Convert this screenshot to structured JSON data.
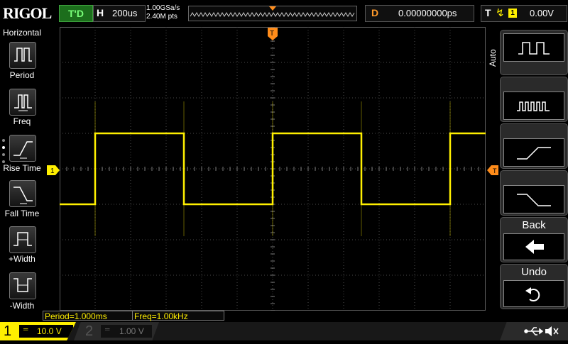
{
  "header": {
    "logo": "RIGOL",
    "trigger_status": "T'D",
    "horizontal_label": "H",
    "timebase": "200us",
    "sample_rate": "1.00GSa/s",
    "memory_depth": "2.40M pts",
    "delay_label": "D",
    "delay_value": "0.00000000ps",
    "trigger_label": "T",
    "trigger_source": "1",
    "trigger_level": "0.00V"
  },
  "left_menu": {
    "title": "Horizontal",
    "items": [
      {
        "label": "Period",
        "icon": "period-icon"
      },
      {
        "label": "Freq",
        "icon": "freq-icon"
      },
      {
        "label": "Rise Time",
        "icon": "rise-time-icon"
      },
      {
        "label": "Fall Time",
        "icon": "fall-time-icon"
      },
      {
        "label": "+Width",
        "icon": "positive-width-icon"
      },
      {
        "label": "-Width",
        "icon": "negative-width-icon"
      }
    ]
  },
  "right_menu": {
    "side_label": "Auto",
    "back_label": "Back",
    "undo_label": "Undo"
  },
  "measurements": {
    "period": "Period=1.000ms",
    "freq": "Freq=1.00kHz"
  },
  "channels": {
    "ch1": {
      "number": "1",
      "scale": "10.0 V",
      "color": "#ffef00"
    },
    "ch2": {
      "number": "2",
      "scale": "1.00 V",
      "color": "#555555"
    }
  },
  "markers": {
    "ch1_marker": "1",
    "trigger_time_marker": "T"
  },
  "chart_data": {
    "type": "line",
    "x_divisions": 12,
    "y_divisions": 8,
    "series": [
      {
        "name": "1",
        "color": "#ffef00",
        "x": [
          0,
          1,
          1,
          3.5,
          3.5,
          6,
          6,
          8.5,
          8.5,
          11,
          11,
          12
        ],
        "y": [
          -1,
          -1,
          1,
          1,
          -1,
          -1,
          1,
          1,
          -1,
          -1,
          1,
          1
        ]
      }
    ]
  }
}
